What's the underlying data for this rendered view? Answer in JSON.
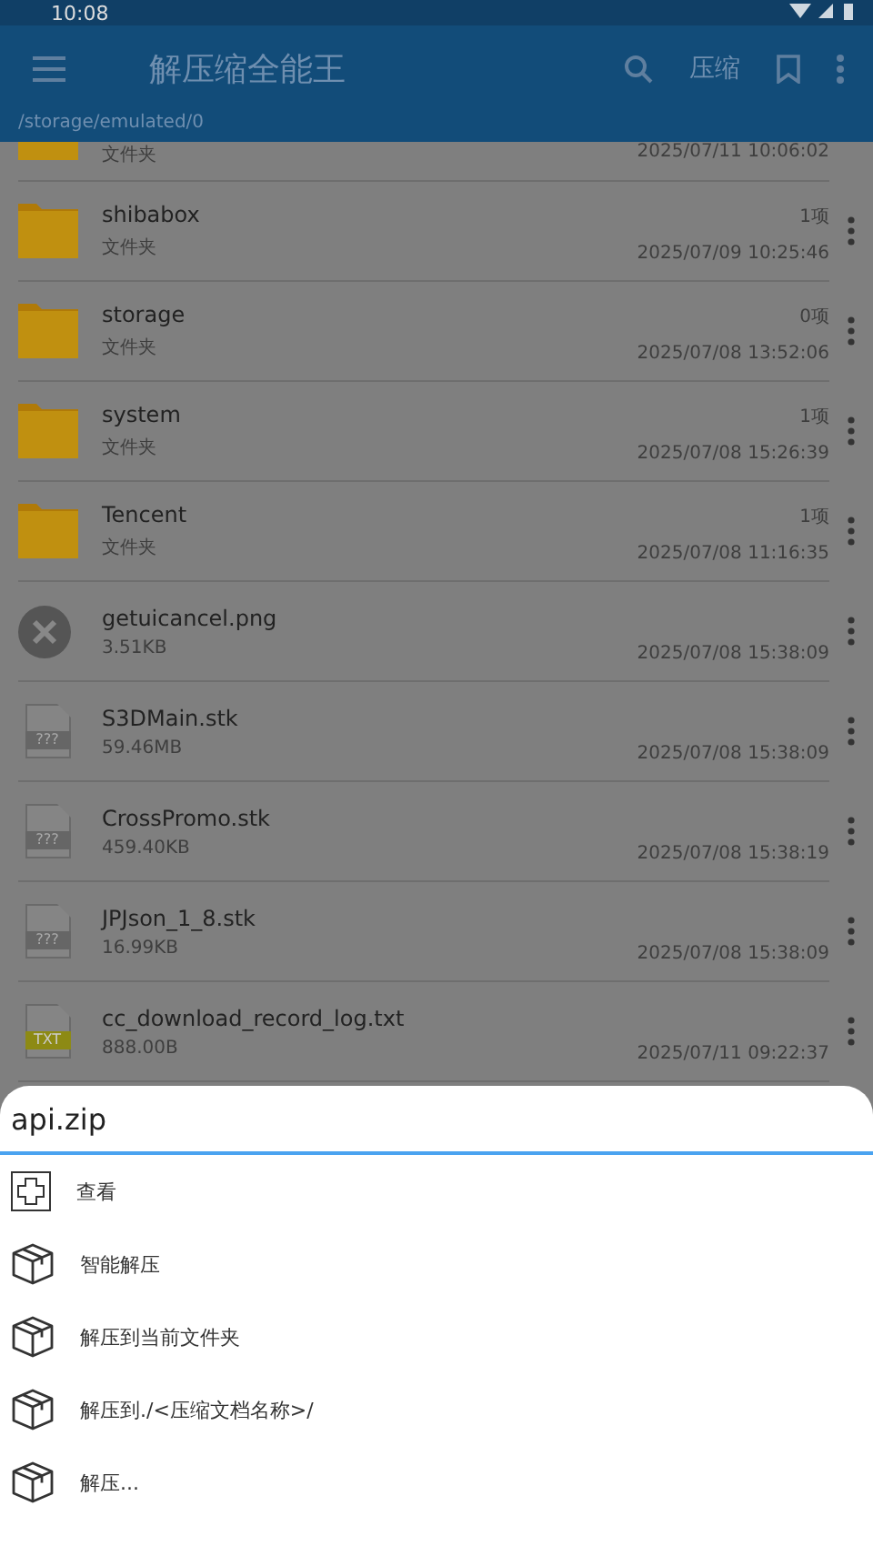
{
  "status_bar": {
    "time": "10:08"
  },
  "app_bar": {
    "title": "解压缩全能王",
    "action_label": "压缩"
  },
  "path": "/storage/emulated/0",
  "files": [
    {
      "kind": "folder",
      "subtitle": "文件夹",
      "date": "2025/07/11 10:06:02"
    },
    {
      "kind": "folder",
      "name": "shibabox",
      "subtitle": "文件夹",
      "count": "1项",
      "date": "2025/07/09 10:25:46"
    },
    {
      "kind": "folder",
      "name": "storage",
      "subtitle": "文件夹",
      "count": "0项",
      "date": "2025/07/08 13:52:06"
    },
    {
      "kind": "folder",
      "name": "system",
      "subtitle": "文件夹",
      "count": "1项",
      "date": "2025/07/08 15:26:39"
    },
    {
      "kind": "folder",
      "name": "Tencent",
      "subtitle": "文件夹",
      "count": "1项",
      "date": "2025/07/08 11:16:35"
    },
    {
      "kind": "broken",
      "name": "getuicancel.png",
      "subtitle": "3.51KB",
      "date": "2025/07/08 15:38:09"
    },
    {
      "kind": "doc",
      "badge": "???",
      "name": "S3DMain.stk",
      "subtitle": "59.46MB",
      "date": "2025/07/08 15:38:09"
    },
    {
      "kind": "doc",
      "badge": "???",
      "name": "CrossPromo.stk",
      "subtitle": "459.40KB",
      "date": "2025/07/08 15:38:19"
    },
    {
      "kind": "doc",
      "badge": "???",
      "name": "JPJson_1_8.stk",
      "subtitle": "16.99KB",
      "date": "2025/07/08 15:38:09"
    },
    {
      "kind": "text",
      "badge": "TXT",
      "name": "cc_download_record_log.txt",
      "subtitle": "888.00B",
      "date": "2025/07/11 09:22:37"
    }
  ],
  "sheet": {
    "title": "api.zip",
    "items": [
      {
        "kind": "view",
        "label": "查看"
      },
      {
        "kind": "box",
        "label": "智能解压"
      },
      {
        "kind": "box",
        "label": "解压到当前文件夹"
      },
      {
        "kind": "box",
        "label": "解压到./<压缩文档名称>/"
      },
      {
        "kind": "box",
        "label": "解压..."
      }
    ]
  }
}
